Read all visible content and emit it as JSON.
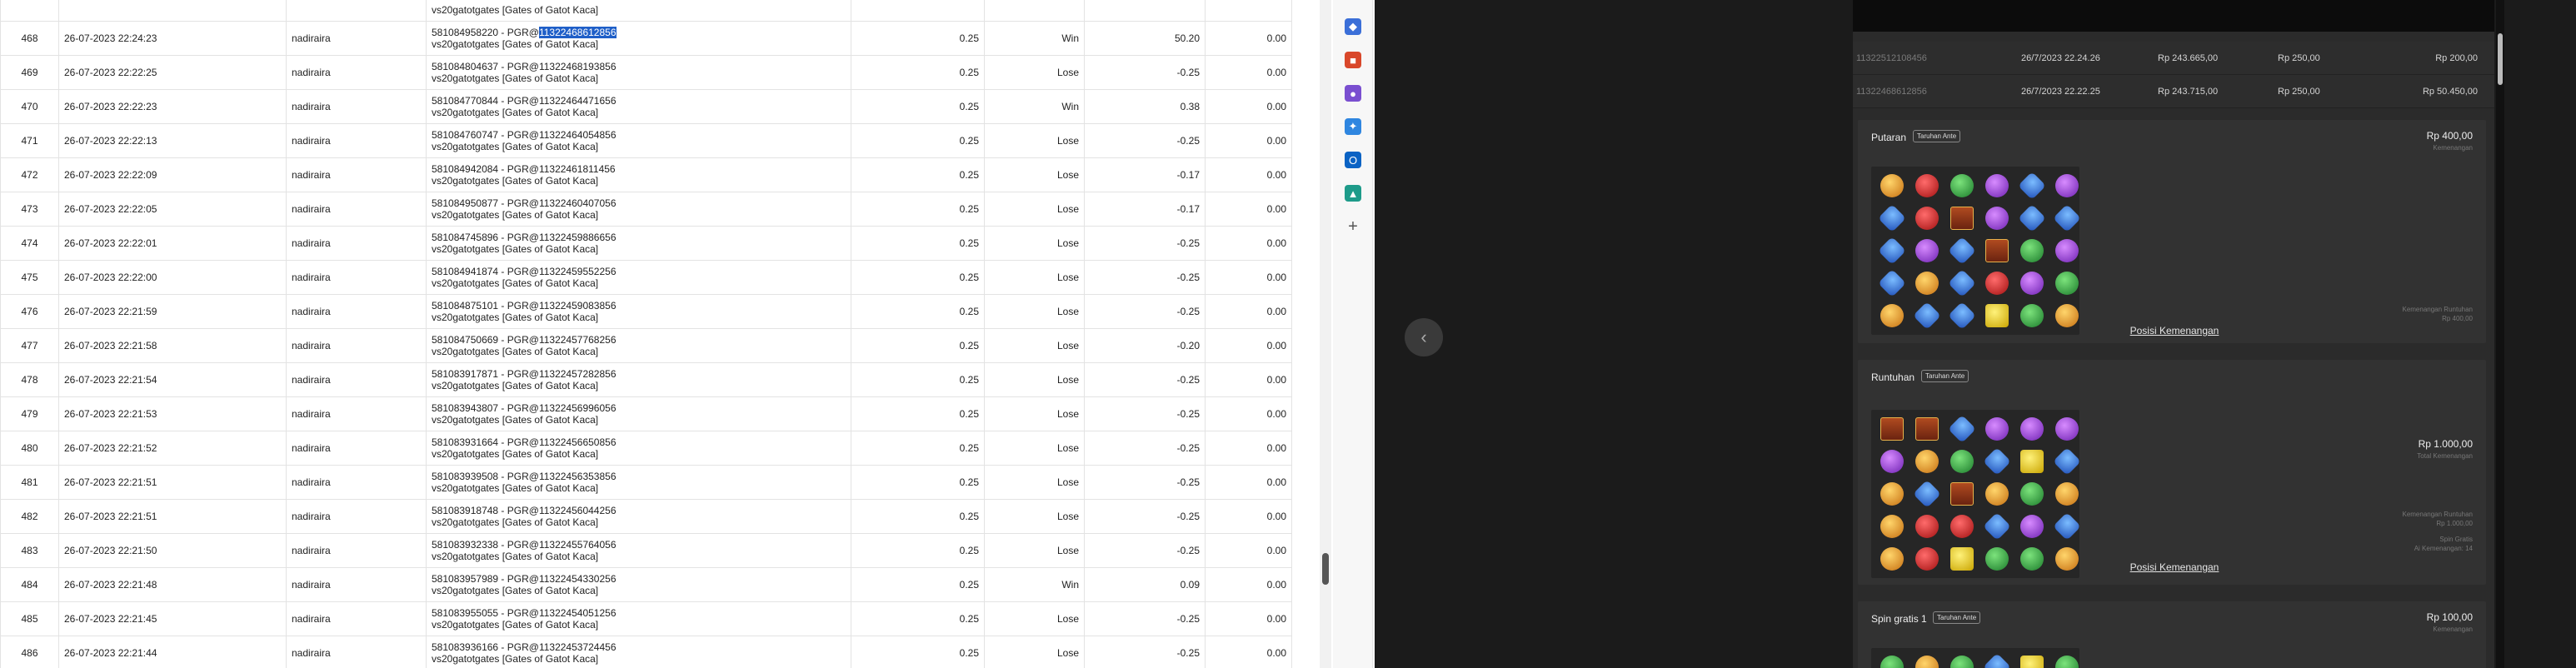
{
  "table": {
    "rows": [
      {
        "no": "468",
        "date": "26-07-2023 22:24:23",
        "user": "nadiraira",
        "id": "581084958220",
        "pgr_prefix": "PGR@",
        "pgr_id": "11322468612856",
        "pgr_highlighted": true,
        "game": "vs20gatotgates [Gates of Gatot Kaca]",
        "bet": "0.25",
        "result": "Win",
        "amount": "50.20",
        "balance": "0.00"
      },
      {
        "no": "469",
        "date": "26-07-2023 22:22:25",
        "user": "nadiraira",
        "id": "581084804637",
        "pgr_prefix": "PGR@",
        "pgr_id": "11322468193856",
        "pgr_highlighted": false,
        "game": "vs20gatotgates [Gates of Gatot Kaca]",
        "bet": "0.25",
        "result": "Lose",
        "amount": "-0.25",
        "balance": "0.00"
      },
      {
        "no": "470",
        "date": "26-07-2023 22:22:23",
        "user": "nadiraira",
        "id": "581084770844",
        "pgr_prefix": "PGR@",
        "pgr_id": "11322464471656",
        "pgr_highlighted": false,
        "game": "vs20gatotgates [Gates of Gatot Kaca]",
        "bet": "0.25",
        "result": "Win",
        "amount": "0.38",
        "balance": "0.00"
      },
      {
        "no": "471",
        "date": "26-07-2023 22:22:13",
        "user": "nadiraira",
        "id": "581084760747",
        "pgr_prefix": "PGR@",
        "pgr_id": "11322464054856",
        "pgr_highlighted": false,
        "game": "vs20gatotgates [Gates of Gatot Kaca]",
        "bet": "0.25",
        "result": "Lose",
        "amount": "-0.25",
        "balance": "0.00"
      },
      {
        "no": "472",
        "date": "26-07-2023 22:22:09",
        "user": "nadiraira",
        "id": "581084942084",
        "pgr_prefix": "PGR@",
        "pgr_id": "11322461811456",
        "pgr_highlighted": false,
        "game": "vs20gatotgates [Gates of Gatot Kaca]",
        "bet": "0.25",
        "result": "Lose",
        "amount": "-0.17",
        "balance": "0.00"
      },
      {
        "no": "473",
        "date": "26-07-2023 22:22:05",
        "user": "nadiraira",
        "id": "581084950877",
        "pgr_prefix": "PGR@",
        "pgr_id": "11322460407056",
        "pgr_highlighted": false,
        "game": "vs20gatotgates [Gates of Gatot Kaca]",
        "bet": "0.25",
        "result": "Lose",
        "amount": "-0.17",
        "balance": "0.00"
      },
      {
        "no": "474",
        "date": "26-07-2023 22:22:01",
        "user": "nadiraira",
        "id": "581084745896",
        "pgr_prefix": "PGR@",
        "pgr_id": "11322459886656",
        "pgr_highlighted": false,
        "game": "vs20gatotgates [Gates of Gatot Kaca]",
        "bet": "0.25",
        "result": "Lose",
        "amount": "-0.25",
        "balance": "0.00"
      },
      {
        "no": "475",
        "date": "26-07-2023 22:22:00",
        "user": "nadiraira",
        "id": "581084941874",
        "pgr_prefix": "PGR@",
        "pgr_id": "11322459552256",
        "pgr_highlighted": false,
        "game": "vs20gatotgates [Gates of Gatot Kaca]",
        "bet": "0.25",
        "result": "Lose",
        "amount": "-0.25",
        "balance": "0.00"
      },
      {
        "no": "476",
        "date": "26-07-2023 22:21:59",
        "user": "nadiraira",
        "id": "581084875101",
        "pgr_prefix": "PGR@",
        "pgr_id": "11322459083856",
        "pgr_highlighted": false,
        "game": "vs20gatotgates [Gates of Gatot Kaca]",
        "bet": "0.25",
        "result": "Lose",
        "amount": "-0.25",
        "balance": "0.00"
      },
      {
        "no": "477",
        "date": "26-07-2023 22:21:58",
        "user": "nadiraira",
        "id": "581084750669",
        "pgr_prefix": "PGR@",
        "pgr_id": "11322457768256",
        "pgr_highlighted": false,
        "game": "vs20gatotgates [Gates of Gatot Kaca]",
        "bet": "0.25",
        "result": "Lose",
        "amount": "-0.20",
        "balance": "0.00"
      },
      {
        "no": "478",
        "date": "26-07-2023 22:21:54",
        "user": "nadiraira",
        "id": "581083917871",
        "pgr_prefix": "PGR@",
        "pgr_id": "11322457282856",
        "pgr_highlighted": false,
        "game": "vs20gatotgates [Gates of Gatot Kaca]",
        "bet": "0.25",
        "result": "Lose",
        "amount": "-0.25",
        "balance": "0.00"
      },
      {
        "no": "479",
        "date": "26-07-2023 22:21:53",
        "user": "nadiraira",
        "id": "581083943807",
        "pgr_prefix": "PGR@",
        "pgr_id": "11322456996056",
        "pgr_highlighted": false,
        "game": "vs20gatotgates [Gates of Gatot Kaca]",
        "bet": "0.25",
        "result": "Lose",
        "amount": "-0.25",
        "balance": "0.00"
      },
      {
        "no": "480",
        "date": "26-07-2023 22:21:52",
        "user": "nadiraira",
        "id": "581083931664",
        "pgr_prefix": "PGR@",
        "pgr_id": "11322456650856",
        "pgr_highlighted": false,
        "game": "vs20gatotgates [Gates of Gatot Kaca]",
        "bet": "0.25",
        "result": "Lose",
        "amount": "-0.25",
        "balance": "0.00"
      },
      {
        "no": "481",
        "date": "26-07-2023 22:21:51",
        "user": "nadiraira",
        "id": "581083939508",
        "pgr_prefix": "PGR@",
        "pgr_id": "11322456353856",
        "pgr_highlighted": false,
        "game": "vs20gatotgates [Gates of Gatot Kaca]",
        "bet": "0.25",
        "result": "Lose",
        "amount": "-0.25",
        "balance": "0.00"
      },
      {
        "no": "482",
        "date": "26-07-2023 22:21:51",
        "user": "nadiraira",
        "id": "581083918748",
        "pgr_prefix": "PGR@",
        "pgr_id": "11322456044256",
        "pgr_highlighted": false,
        "game": "vs20gatotgates [Gates of Gatot Kaca]",
        "bet": "0.25",
        "result": "Lose",
        "amount": "-0.25",
        "balance": "0.00"
      },
      {
        "no": "483",
        "date": "26-07-2023 22:21:50",
        "user": "nadiraira",
        "id": "581083932338",
        "pgr_prefix": "PGR@",
        "pgr_id": "11322455764056",
        "pgr_highlighted": false,
        "game": "vs20gatotgates [Gates of Gatot Kaca]",
        "bet": "0.25",
        "result": "Lose",
        "amount": "-0.25",
        "balance": "0.00"
      },
      {
        "no": "484",
        "date": "26-07-2023 22:21:48",
        "user": "nadiraira",
        "id": "581083957989",
        "pgr_prefix": "PGR@",
        "pgr_id": "11322454330256",
        "pgr_highlighted": false,
        "game": "vs20gatotgates [Gates of Gatot Kaca]",
        "bet": "0.25",
        "result": "Win",
        "amount": "0.09",
        "balance": "0.00"
      },
      {
        "no": "485",
        "date": "26-07-2023 22:21:45",
        "user": "nadiraira",
        "id": "581083955055",
        "pgr_prefix": "PGR@",
        "pgr_id": "11322454051256",
        "pgr_highlighted": false,
        "game": "vs20gatotgates [Gates of Gatot Kaca]",
        "bet": "0.25",
        "result": "Lose",
        "amount": "-0.25",
        "balance": "0.00"
      },
      {
        "no": "486",
        "date": "26-07-2023 22:21:44",
        "user": "nadiraira",
        "id": "581083936166",
        "pgr_prefix": "PGR@",
        "pgr_id": "11322453724456",
        "pgr_highlighted": false,
        "game": "vs20gatotgates [Gates of Gatot Kaca]",
        "bet": "0.25",
        "result": "Lose",
        "amount": "-0.25",
        "balance": "0.00"
      }
    ]
  },
  "extensions": [
    {
      "name": "tag-extension-icon",
      "color": "#3b6fd8",
      "glyph": "◆"
    },
    {
      "name": "toolbox-extension-icon",
      "color": "#d9482b",
      "glyph": "■"
    },
    {
      "name": "people-extension-icon",
      "color": "#7a4fd0",
      "glyph": "●"
    },
    {
      "name": "copilot-extension-icon",
      "color": "#2f86e0",
      "glyph": "✦"
    },
    {
      "name": "outlook-extension-icon",
      "color": "#0b63c4",
      "glyph": "O"
    },
    {
      "name": "shopping-extension-icon",
      "color": "#1e9b8a",
      "glyph": "▲"
    }
  ],
  "history": {
    "rows": [
      {
        "id": "11322512108456",
        "date": "26/7/2023 22.24.26",
        "balance": "Rp 243.665,00",
        "bet": "Rp 250,00",
        "win": "Rp 200,00"
      },
      {
        "id": "11322468612856",
        "date": "26/7/2023 22.22.25",
        "balance": "Rp 243.715,00",
        "bet": "Rp 250,00",
        "win": "Rp 50.450,00"
      }
    ]
  },
  "cards": {
    "putaran": {
      "title": "Putaran",
      "badge": "Taruhan Ante",
      "amount": "Rp 400,00",
      "amount_sub": "Kemenangan",
      "detail_label": "Kemenangan Runtuhan",
      "detail_value": "Rp 400,00",
      "link": "Posisi Kemenangan",
      "grid": [
        [
          "gold",
          "red",
          "green",
          "purple",
          "blue",
          "purple"
        ],
        [
          "blue",
          "red",
          "scatter",
          "purple",
          "blue",
          "blue"
        ],
        [
          "blue",
          "purple",
          "blue",
          "scatter",
          "green",
          "purple"
        ],
        [
          "blue",
          "gold",
          "blue",
          "red",
          "purple",
          "green"
        ],
        [
          "gold",
          "blue",
          "blue",
          "yellow",
          "green",
          "gold"
        ]
      ]
    },
    "runtuhan": {
      "title": "Runtuhan",
      "badge": "Taruhan Ante",
      "amount": "Rp 1.000,00",
      "amount_sub": "Total Kemenangan",
      "detail_label": "Kemenangan Runtuhan",
      "detail_value": "Rp 1.000,00",
      "detail_label2": "Spin Gratis",
      "detail_value2": "Ai Kemenangan: 14",
      "link": "Posisi Kemenangan",
      "grid": [
        [
          "scatter",
          "scatter",
          "blue",
          "purple",
          "purple",
          "purple"
        ],
        [
          "purple",
          "gold",
          "green",
          "blue",
          "yellow",
          "blue"
        ],
        [
          "gold",
          "blue",
          "scatter",
          "gold",
          "green",
          "gold"
        ],
        [
          "gold",
          "red",
          "red",
          "blue",
          "purple",
          "blue"
        ],
        [
          "gold",
          "red",
          "yellow",
          "green",
          "green",
          "gold"
        ]
      ]
    },
    "spin_gratis": {
      "title": "Spin gratis",
      "title_suffix": "1",
      "badge": "Taruhan Ante",
      "amount": "Rp 100,00",
      "amount_sub": "Kemenangan",
      "grid": [
        [
          "green",
          "gold",
          "green",
          "blue",
          "yellow",
          "green"
        ]
      ]
    }
  },
  "colors": {
    "win": "#2e9b3c",
    "lose": "#e02525",
    "highlight": "#1f5fc8",
    "panel_bg": "#2b2b2b"
  }
}
